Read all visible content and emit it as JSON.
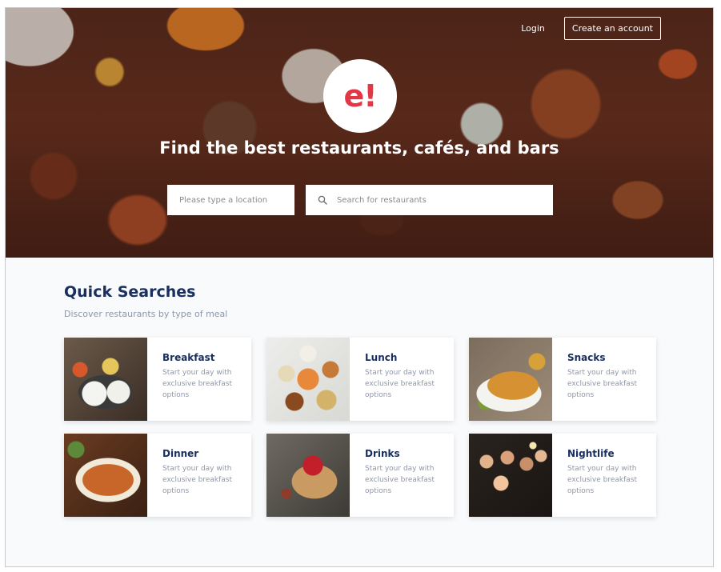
{
  "header": {
    "login_label": "Login",
    "create_account_label": "Create an account"
  },
  "hero": {
    "logo_text": "e!",
    "headline": "Find the best restaurants, cafés, and bars",
    "location_placeholder": "Please type a location",
    "search_placeholder": "Search for restaurants"
  },
  "quick_searches": {
    "title": "Quick Searches",
    "subtitle": "Discover restaurants by type of meal",
    "cards": [
      {
        "name": "breakfast",
        "title": "Breakfast",
        "description": "Start your day with exclusive breakfast options"
      },
      {
        "name": "lunch",
        "title": "Lunch",
        "description": "Start your day with exclusive breakfast options"
      },
      {
        "name": "snacks",
        "title": "Snacks",
        "description": "Start your day with exclusive breakfast options"
      },
      {
        "name": "dinner",
        "title": "Dinner",
        "description": "Start your day with exclusive breakfast options"
      },
      {
        "name": "drinks",
        "title": "Drinks",
        "description": "Start your day with exclusive breakfast options"
      },
      {
        "name": "nightlife",
        "title": "Nightlife",
        "description": "Start your day with exclusive breakfast options"
      }
    ]
  },
  "colors": {
    "brand_red": "#e23744",
    "heading_navy": "#192f60",
    "muted_text": "#8c96ab"
  }
}
